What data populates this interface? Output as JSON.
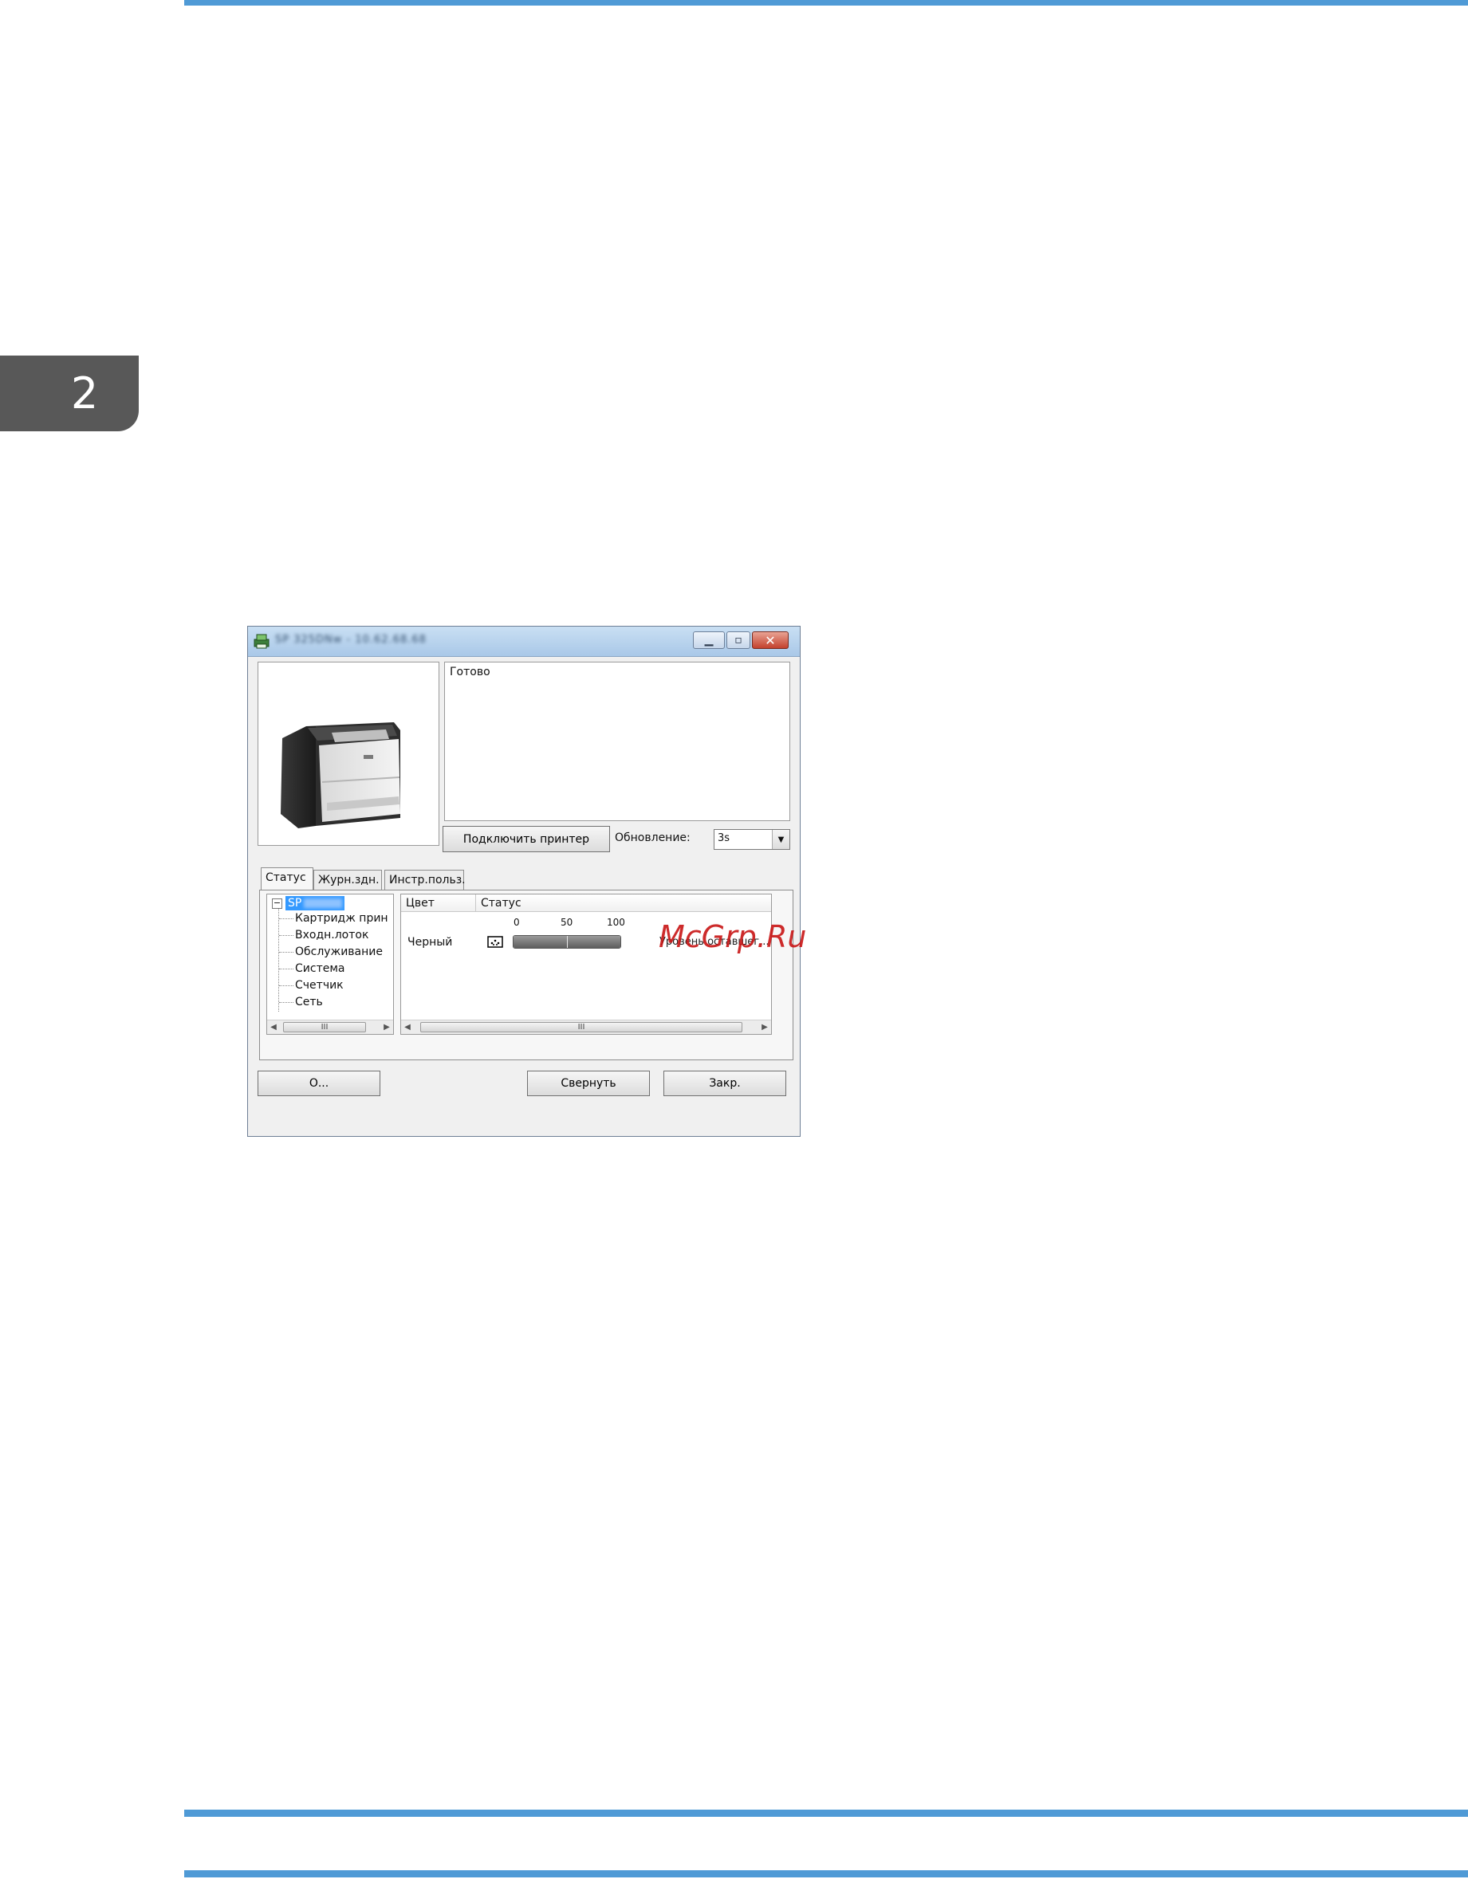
{
  "chapter_number": "2",
  "window": {
    "title": "SP 325DNw - 10.62.68.68",
    "status_text": "Готово",
    "connect_button": "Подключить принтер",
    "refresh_label": "Обновление:",
    "refresh_value": "3s",
    "tabs": [
      "Статус",
      "Журн.здн.",
      "Инстр.польз."
    ],
    "tree": {
      "root_label": "SP",
      "items": [
        "Картридж прин",
        "Входн.лоток",
        "Обслуживание",
        "Система",
        "Счетчик",
        "Сеть"
      ],
      "scroll_thumb": "III"
    },
    "list": {
      "columns": [
        "Цвет",
        "Статус"
      ],
      "scale": [
        "0",
        "50",
        "100"
      ],
      "row": {
        "color": "Черный",
        "level_percent": 100,
        "status": "Уровень оставшег..."
      },
      "scroll_thumb": "III"
    },
    "buttons": {
      "about": "О...",
      "minimize": "Свернуть",
      "close": "Закр."
    }
  },
  "watermark": "McGrp.Ru",
  "colors": {
    "accent_rule": "#4f9ad6",
    "chapter_tab": "#585858",
    "selection": "#3399ff",
    "watermark": "#c81414"
  }
}
